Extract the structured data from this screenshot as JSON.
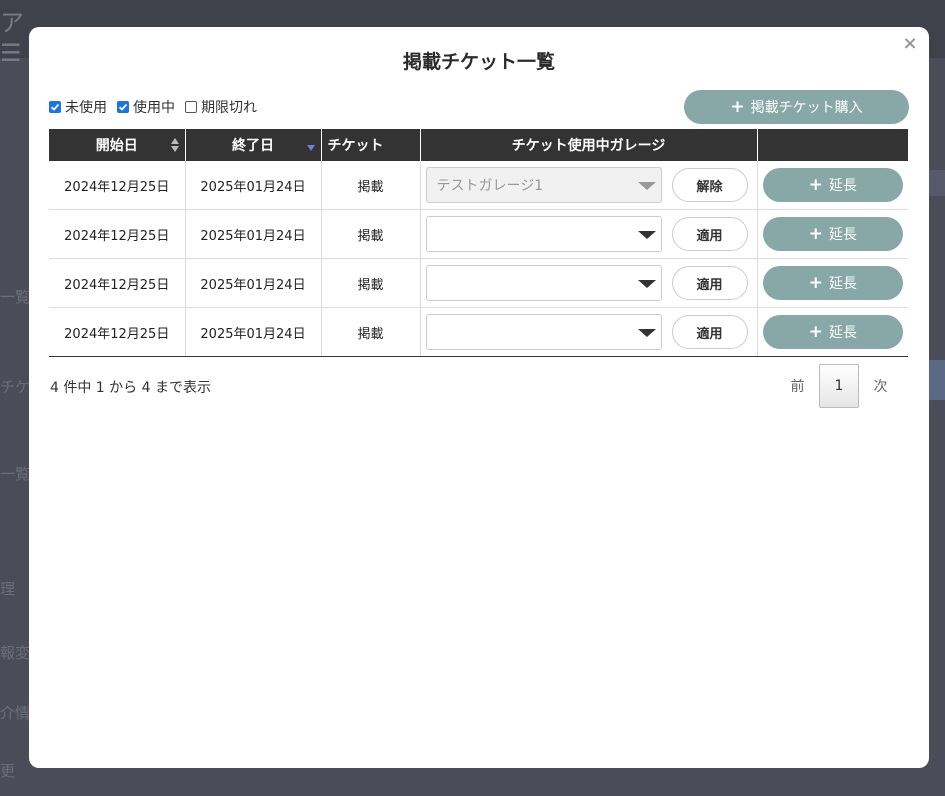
{
  "background": {
    "nav_items": [
      "一覧",
      "チケ",
      "一覧",
      "理",
      "報変",
      "介情",
      "更"
    ]
  },
  "modal": {
    "title": "掲載チケット一覧",
    "close_glyph": "×",
    "filters": [
      {
        "label": "未使用",
        "checked": true
      },
      {
        "label": "使用中",
        "checked": true
      },
      {
        "label": "期限切れ",
        "checked": false
      }
    ],
    "buy_button": "掲載チケット購入",
    "table": {
      "columns": [
        "開始日",
        "終了日",
        "チケット",
        "チケット使用中ガレージ",
        ""
      ],
      "rows": [
        {
          "start": "2024年12月25日",
          "end": "2025年01月24日",
          "ticket": "掲載",
          "garage": "テストガレージ1",
          "garage_disabled": true,
          "action": "解除",
          "extend": "延長"
        },
        {
          "start": "2024年12月25日",
          "end": "2025年01月24日",
          "ticket": "掲載",
          "garage": "",
          "garage_disabled": false,
          "action": "適用",
          "extend": "延長"
        },
        {
          "start": "2024年12月25日",
          "end": "2025年01月24日",
          "ticket": "掲載",
          "garage": "",
          "garage_disabled": false,
          "action": "適用",
          "extend": "延長"
        },
        {
          "start": "2024年12月25日",
          "end": "2025年01月24日",
          "ticket": "掲載",
          "garage": "",
          "garage_disabled": false,
          "action": "適用",
          "extend": "延長"
        }
      ]
    },
    "summary": "4 件中 1 から 4 まで表示",
    "pagination": {
      "prev": "前",
      "current": "1",
      "next": "次"
    }
  },
  "colors": {
    "accent_button": "#87a8a6",
    "header_bg": "#333333",
    "checkbox": "#1a73e8"
  }
}
